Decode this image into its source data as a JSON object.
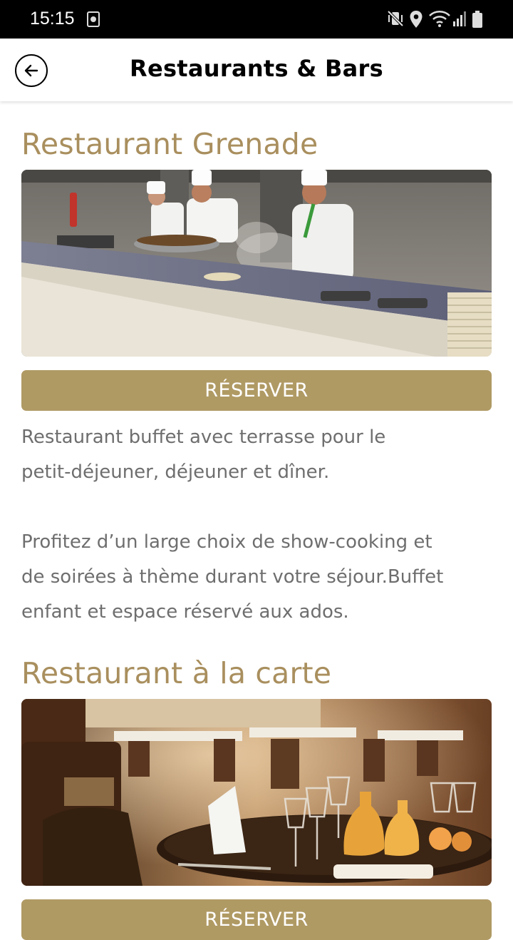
{
  "status_bar": {
    "time": "15:15",
    "icons": [
      "screenshot-icon",
      "mute-vibrate-icon",
      "location-icon",
      "wifi-icon",
      "signal-icon",
      "battery-icon"
    ]
  },
  "header": {
    "title": "Restaurants & Bars",
    "back_icon": "arrow-left-circle-icon"
  },
  "colors": {
    "accent": "#a98f5e",
    "button": "#b09a64",
    "text": "#6e6e6e"
  },
  "restaurants": [
    {
      "name": "Restaurant Grenade",
      "button_label": "RÉSERVER",
      "description_lines": [
        "Restaurant buffet avec terrasse pour le",
        "petit-déjeuner, déjeuner et dîner.",
        "",
        "Profitez d’un large choix de show-cooking et",
        "de soirées à thème durant votre séjour.Buffet",
        "enfant et espace réservé aux ados."
      ]
    },
    {
      "name": "Restaurant à la carte",
      "button_label": "RÉSERVER"
    }
  ]
}
